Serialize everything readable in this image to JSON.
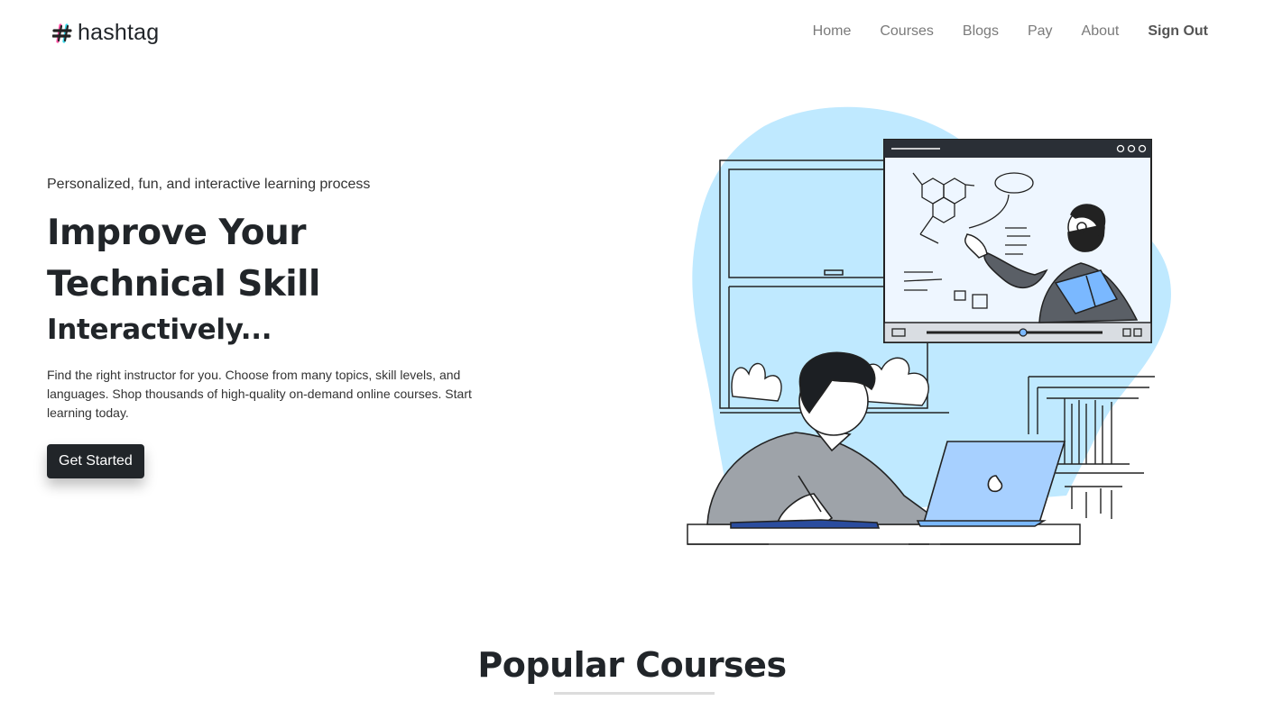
{
  "brand": {
    "name": "hashtag",
    "logo_icon": "hashtag-logo-icon",
    "logo_colors": [
      "#ff4fa3",
      "#3ad6e8",
      "#222222"
    ]
  },
  "nav": {
    "items": [
      {
        "label": "Home"
      },
      {
        "label": "Courses"
      },
      {
        "label": "Blogs"
      },
      {
        "label": "Pay"
      },
      {
        "label": "About"
      },
      {
        "label": "Sign Out"
      }
    ]
  },
  "hero": {
    "tagline": "Personalized, fun, and interactive learning process",
    "headline_line1": "Improve Your",
    "headline_line2": "Technical Skill",
    "headline_line3": "Interactively...",
    "description": "Find the right instructor for you. Choose from many topics, skill levels, and languages. Shop thousands of high-quality on-demand online courses. Start learning today.",
    "cta_label": "Get Started",
    "illustration": "online-learning-illustration",
    "illustration_accent": "#bfe9ff"
  },
  "popular": {
    "title": "Popular Courses"
  }
}
